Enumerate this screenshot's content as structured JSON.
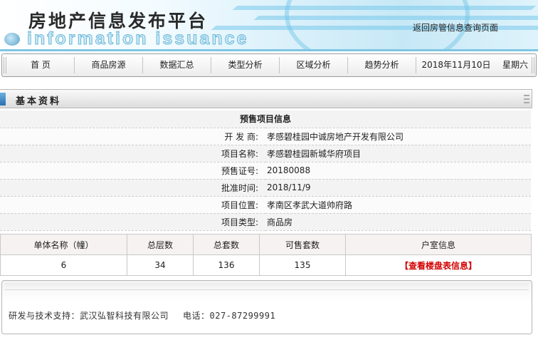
{
  "header": {
    "title": "房地产信息发布平台",
    "logo_text": "information issuance",
    "back_link": "返回房管信息查询页面"
  },
  "nav": {
    "items": [
      "首 页",
      "商品房源",
      "数据汇总",
      "类型分析",
      "区域分析",
      "趋势分析"
    ],
    "date": "2018年11月10日",
    "weekday": "星期六"
  },
  "section": {
    "title": "基本资料"
  },
  "project": {
    "heading": "预售项目信息",
    "rows": [
      {
        "label": "开 发 商:",
        "value": "孝感碧桂园中诚房地产开发有限公司"
      },
      {
        "label": "项目名称:",
        "value": "孝感碧桂园新城华府项目"
      },
      {
        "label": "预售证号:",
        "value": "20180088"
      },
      {
        "label": "批准时间:",
        "value": "2018/11/9"
      },
      {
        "label": "项目位置:",
        "value": "孝南区孝武大道帅府路"
      },
      {
        "label": "项目类型:",
        "value": "商品房"
      }
    ]
  },
  "buildings": {
    "headers": [
      "单体名称（幢）",
      "总层数",
      "总套数",
      "可售套数",
      "户室信息"
    ],
    "rows": [
      {
        "name": "6",
        "floors": "34",
        "total": "136",
        "available": "135",
        "link": "【查看楼盘表信息】"
      }
    ]
  },
  "footer": {
    "support": "研发与技术支持：武汉弘智科技有限公司",
    "phone": "电话：027-87299991"
  },
  "colors": {
    "accent": "#d40000",
    "banner": "#c6e8f6",
    "marker": "#2a6fb0"
  }
}
